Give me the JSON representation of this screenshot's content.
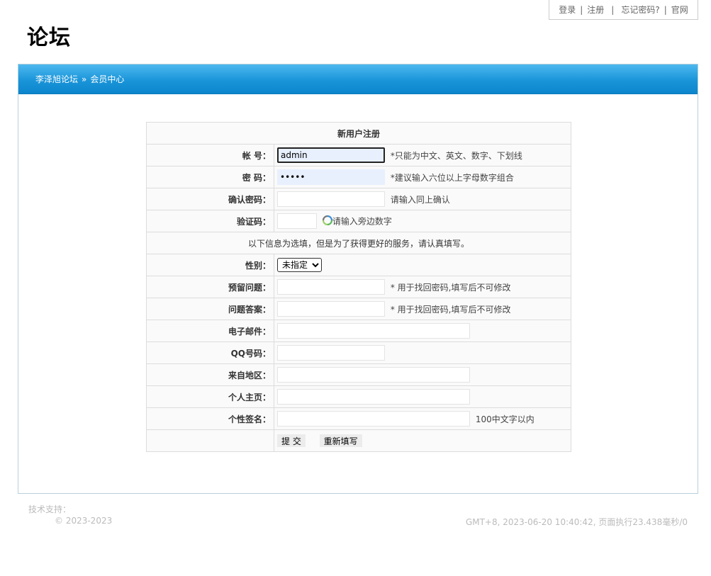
{
  "top_links": {
    "login": "登录",
    "sep1": "|",
    "register": "注册",
    "sep2": "|",
    "forgot": "忘记密码?",
    "sep3": "|",
    "official": "官网"
  },
  "site_title": "论坛",
  "breadcrumb": {
    "forum": "李泽旭论坛",
    "arrow": "»",
    "current": "会员中心"
  },
  "form": {
    "title": "新用户注册",
    "account": {
      "label": "帐 号：",
      "value": "admin",
      "hint": "*只能为中文、英文、数字、下划线"
    },
    "password": {
      "label": "密 码：",
      "value": "•••••",
      "hint": "*建议输入六位以上字母数字组合"
    },
    "confirm": {
      "label": "确认密码：",
      "value": "",
      "hint": "请输入同上确认"
    },
    "captcha": {
      "label": "验证码：",
      "value": "",
      "hint": "请输入旁边数字"
    },
    "optional_note": "以下信息为选填，但是为了获得更好的服务，请认真填写。",
    "gender": {
      "label": "性别：",
      "selected": "未指定"
    },
    "question": {
      "label": "预留问题：",
      "value": "",
      "hint": "* 用于找回密码,填写后不可修改"
    },
    "answer": {
      "label": "问题答案：",
      "value": "",
      "hint": "* 用于找回密码,填写后不可修改"
    },
    "email": {
      "label": "电子邮件：",
      "value": ""
    },
    "qq": {
      "label": "QQ号码：",
      "value": ""
    },
    "region": {
      "label": "来自地区：",
      "value": ""
    },
    "homepage": {
      "label": "个人主页：",
      "value": ""
    },
    "signature": {
      "label": "个性签名：",
      "value": "",
      "hint": "100中文字以内"
    },
    "submit": "提 交",
    "reset": "重新填写"
  },
  "footer": {
    "support": "技术支持：",
    "copyright": "© 2023-2023",
    "status": "GMT+8, 2023-06-20 10:40:42, 页面执行23.438毫秒/0"
  },
  "colors": {
    "header_blue": "#1a95d9",
    "border": "#dcdcdc",
    "footer_gray": "#bbbbbb"
  }
}
